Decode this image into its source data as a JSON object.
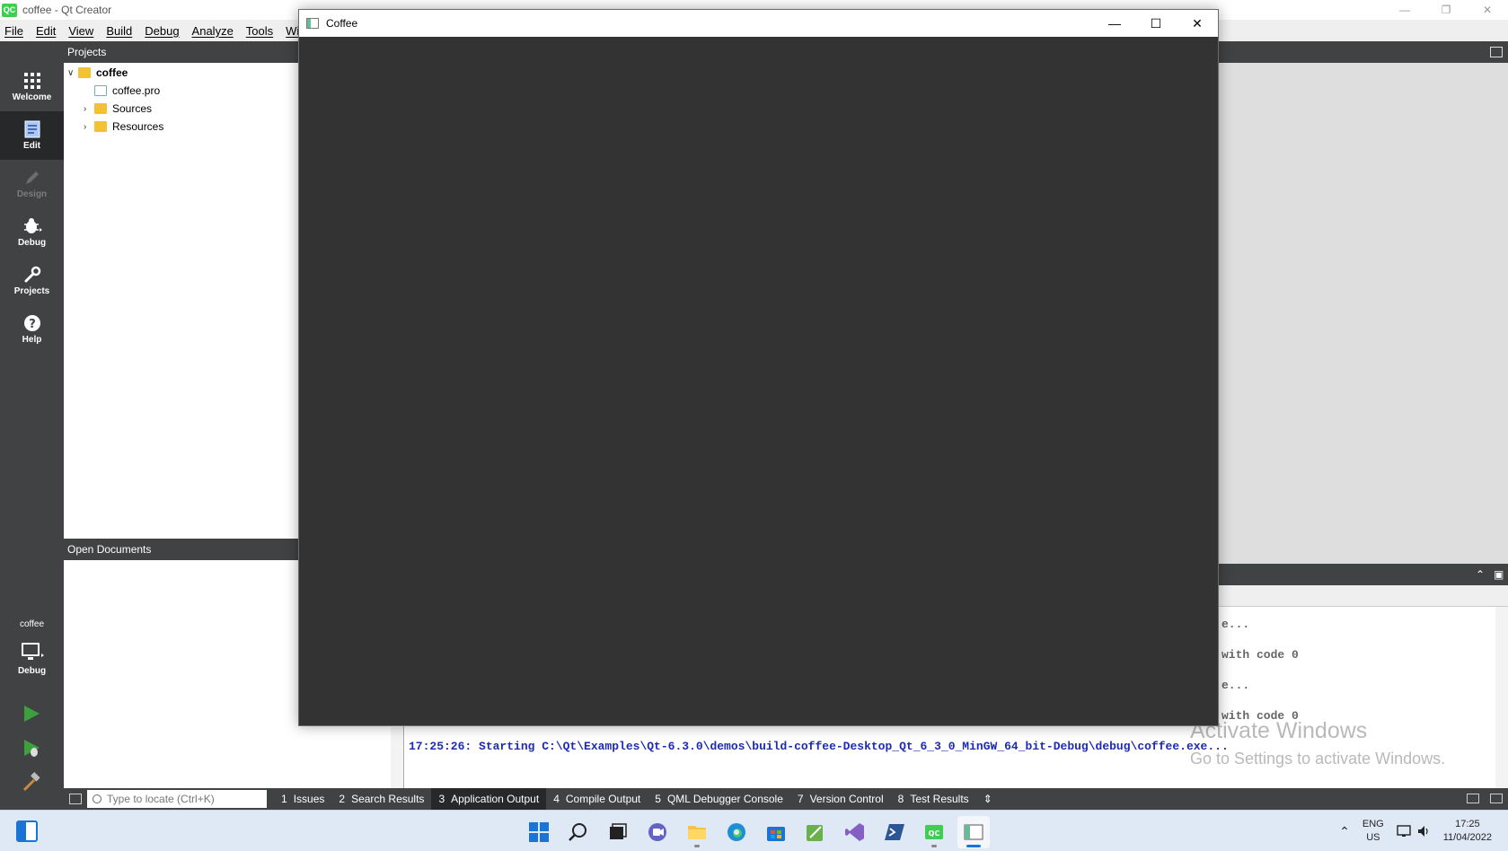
{
  "qt_window": {
    "title": "coffee - Qt Creator",
    "logo_text": "QC"
  },
  "menu": [
    "File",
    "Edit",
    "View",
    "Build",
    "Debug",
    "Analyze",
    "Tools",
    "Wi"
  ],
  "modes": [
    {
      "label": "Welcome",
      "icon": "grid-icon",
      "state": "normal"
    },
    {
      "label": "Edit",
      "icon": "edit-document-icon",
      "state": "active"
    },
    {
      "label": "Design",
      "icon": "pencil-icon",
      "state": "disabled"
    },
    {
      "label": "Debug",
      "icon": "bug-icon",
      "state": "normal"
    },
    {
      "label": "Projects",
      "icon": "wrench-icon",
      "state": "normal"
    },
    {
      "label": "Help",
      "icon": "help-icon",
      "state": "normal"
    }
  ],
  "kit": {
    "project_name": "coffee",
    "build_config": "Debug"
  },
  "projects_panel": {
    "header": "Projects",
    "tree": [
      {
        "label": "coffee",
        "level": 0,
        "expanded": true,
        "bold": true
      },
      {
        "label": "coffee.pro",
        "level": 1,
        "expanded": null,
        "bold": false
      },
      {
        "label": "Sources",
        "level": 1,
        "expanded": false,
        "bold": false
      },
      {
        "label": "Resources",
        "level": 1,
        "expanded": false,
        "bold": false
      }
    ]
  },
  "open_documents": {
    "header": "Open Documents"
  },
  "output_lines": [
    {
      "text": "e...",
      "style": "gray"
    },
    {
      "text": "with code 0",
      "style": "gray"
    },
    {
      "text": "e...",
      "style": "gray"
    },
    {
      "text": "with code 0",
      "style": "gray"
    },
    {
      "text": "17:25:26: Starting C:\\Qt\\Examples\\Qt-6.3.0\\demos\\build-coffee-Desktop_Qt_6_3_0_MinGW_64_bit-Debug\\debug\\coffee.exe...",
      "style": "blue"
    }
  ],
  "watermark": {
    "line1": "Activate Windows",
    "line2": "Go to Settings to activate Windows."
  },
  "statusbar": {
    "locator_placeholder": "Type to locate (Ctrl+K)",
    "tabs": [
      {
        "num": "1",
        "label": "Issues"
      },
      {
        "num": "2",
        "label": "Search Results"
      },
      {
        "num": "3",
        "label": "Application Output"
      },
      {
        "num": "4",
        "label": "Compile Output"
      },
      {
        "num": "5",
        "label": "QML Debugger Console"
      },
      {
        "num": "7",
        "label": "Version Control"
      },
      {
        "num": "8",
        "label": "Test Results"
      }
    ],
    "active_tab": "Application Output"
  },
  "coffee_window": {
    "title": "Coffee",
    "background": "#333333"
  },
  "taskbar": {
    "apps": [
      "windows-start-icon",
      "search-icon",
      "task-view-icon",
      "chat-icon",
      "file-explorer-icon",
      "edge-icon",
      "store-icon",
      "app-icon",
      "visual-studio-icon",
      "powershell-icon",
      "qt-creator-icon",
      "coffee-app-icon"
    ],
    "lang": "ENG",
    "region": "US",
    "time": "17:25",
    "date": "11/04/2022"
  },
  "colors": {
    "sidebar": "#404244",
    "sidebar_active": "#262829",
    "run_green": "#3ca13c",
    "output_blue": "#1c2bb0"
  }
}
